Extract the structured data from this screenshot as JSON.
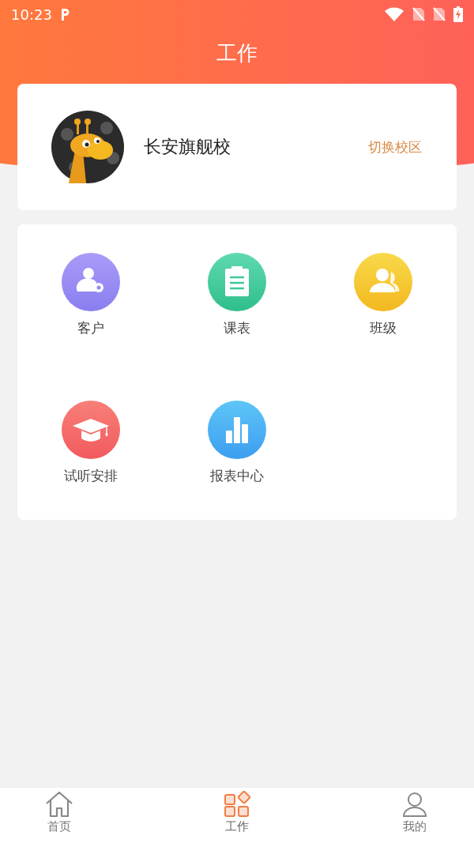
{
  "status_bar": {
    "time": "10:23"
  },
  "header": {
    "title": "工作"
  },
  "campus": {
    "name": "长安旗舰校",
    "switch_link": "切换校区"
  },
  "apps": [
    {
      "label": "客户",
      "kind": "customer"
    },
    {
      "label": "课表",
      "kind": "schedule"
    },
    {
      "label": "班级",
      "kind": "class"
    },
    {
      "label": "试听安排",
      "kind": "trial"
    },
    {
      "label": "报表中心",
      "kind": "report"
    }
  ],
  "tab_bar": [
    {
      "label": "首页",
      "kind": "home",
      "selected": false
    },
    {
      "label": "工作",
      "kind": "work",
      "selected": true
    },
    {
      "label": "我的",
      "kind": "me",
      "selected": false
    }
  ]
}
